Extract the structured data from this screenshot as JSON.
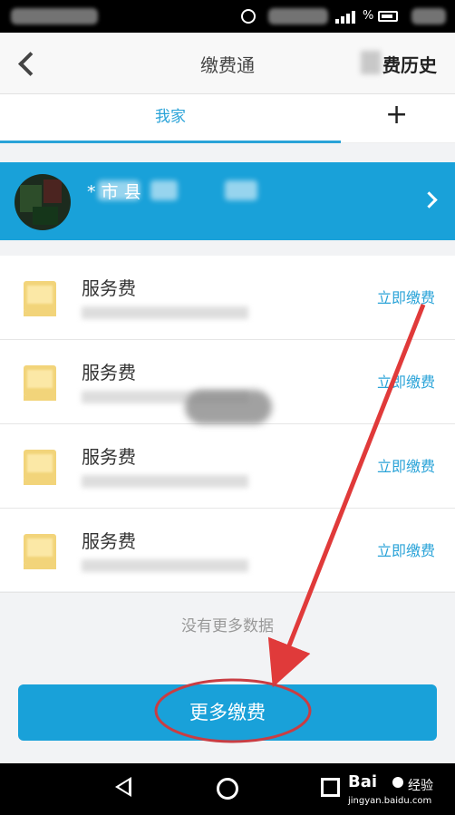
{
  "header": {
    "title": "缴费通",
    "history_label": "费历史"
  },
  "tabs": {
    "home_label": "我家",
    "add_label": "+"
  },
  "account": {
    "address": "*         市    县"
  },
  "bills": [
    {
      "name": "服务费",
      "action": "立即缴费"
    },
    {
      "name": "服务费",
      "action": "立即缴费"
    },
    {
      "name": "服务费",
      "action": "立即缴费"
    },
    {
      "name": "服务费",
      "action": "立即缴费"
    }
  ],
  "no_more_text": "没有更多数据",
  "more_button_label": "更多缴费",
  "watermark": {
    "brand": "Bai",
    "name": "经验",
    "url": "jingyan.baidu.com"
  },
  "colors": {
    "accent": "#19a1d9",
    "link": "#2aa3d8",
    "annotation": "#e03a3a"
  },
  "icons": [
    "back-arrow-icon",
    "plus-icon",
    "chevron-right-icon",
    "bill-icon",
    "nav-back-icon",
    "nav-home-icon",
    "nav-recent-icon"
  ]
}
